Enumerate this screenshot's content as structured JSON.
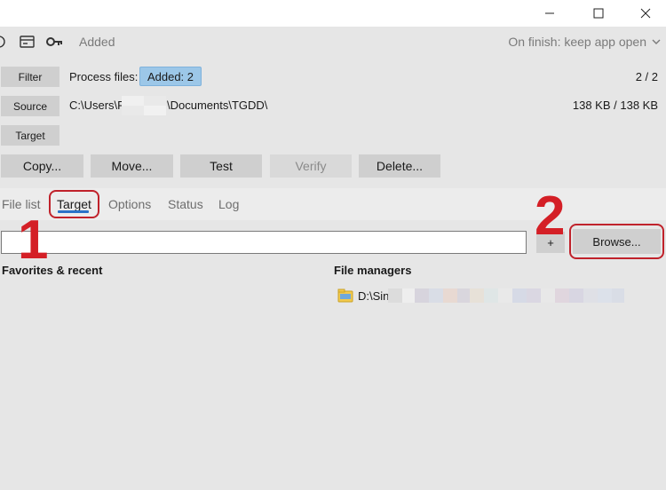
{
  "toolbar": {
    "status": "Added",
    "on_finish": "On finish: keep app open"
  },
  "rows": {
    "filter_label": "Filter",
    "process_files_label": "Process files:",
    "added_badge": "Added: 2",
    "count": "2 / 2",
    "source_label": "Source",
    "source_path_start": "C:\\Users\\P",
    "source_path_end": "\\Documents\\TGDD\\",
    "size": "138 KB / 138 KB",
    "target_label": "Target"
  },
  "actions": {
    "copy": "Copy...",
    "move": "Move...",
    "test": "Test",
    "verify": "Verify",
    "delete": "Delete..."
  },
  "tabs": [
    {
      "label": "File list"
    },
    {
      "label": "Target"
    },
    {
      "label": "Options"
    },
    {
      "label": "Status"
    },
    {
      "label": "Log"
    }
  ],
  "target_panel": {
    "path_value": "",
    "plus_label": "+",
    "browse_label": "Browse...",
    "favorites_heading": "Favorites & recent",
    "file_managers_heading": "File managers",
    "file_manager_item": "D:\\Sin"
  },
  "annotations": {
    "step1": "1",
    "step2": "2"
  },
  "colors": {
    "accent": "#2a72c8",
    "badge": "#9cc7e8",
    "annotation": "#d41f26"
  }
}
